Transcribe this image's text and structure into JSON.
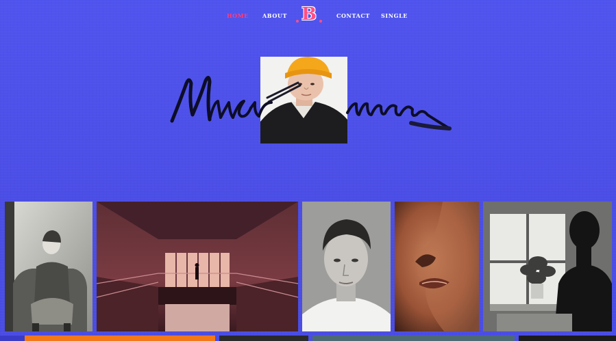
{
  "nav": {
    "items": [
      {
        "label": "Home",
        "active": true
      },
      {
        "label": "About",
        "active": false
      },
      {
        "label": "Contact",
        "active": false
      },
      {
        "label": "Single",
        "active": false
      }
    ],
    "logo": "B"
  },
  "hero": {
    "signature_text": "Musicman",
    "portrait_icon": "person-yellow-beanie-portrait"
  },
  "gallery": {
    "items": [
      {
        "icon": "woman-seated-armchair-photo"
      },
      {
        "icon": "figure-in-hall-photo"
      },
      {
        "icon": "young-man-portrait-photo"
      },
      {
        "icon": "face-closeup-photo"
      },
      {
        "icon": "man-at-window-photo"
      }
    ]
  },
  "colors": {
    "background": "#4c4fe8",
    "accent": "#ff3c7c",
    "nav_text": "#ffffff"
  }
}
